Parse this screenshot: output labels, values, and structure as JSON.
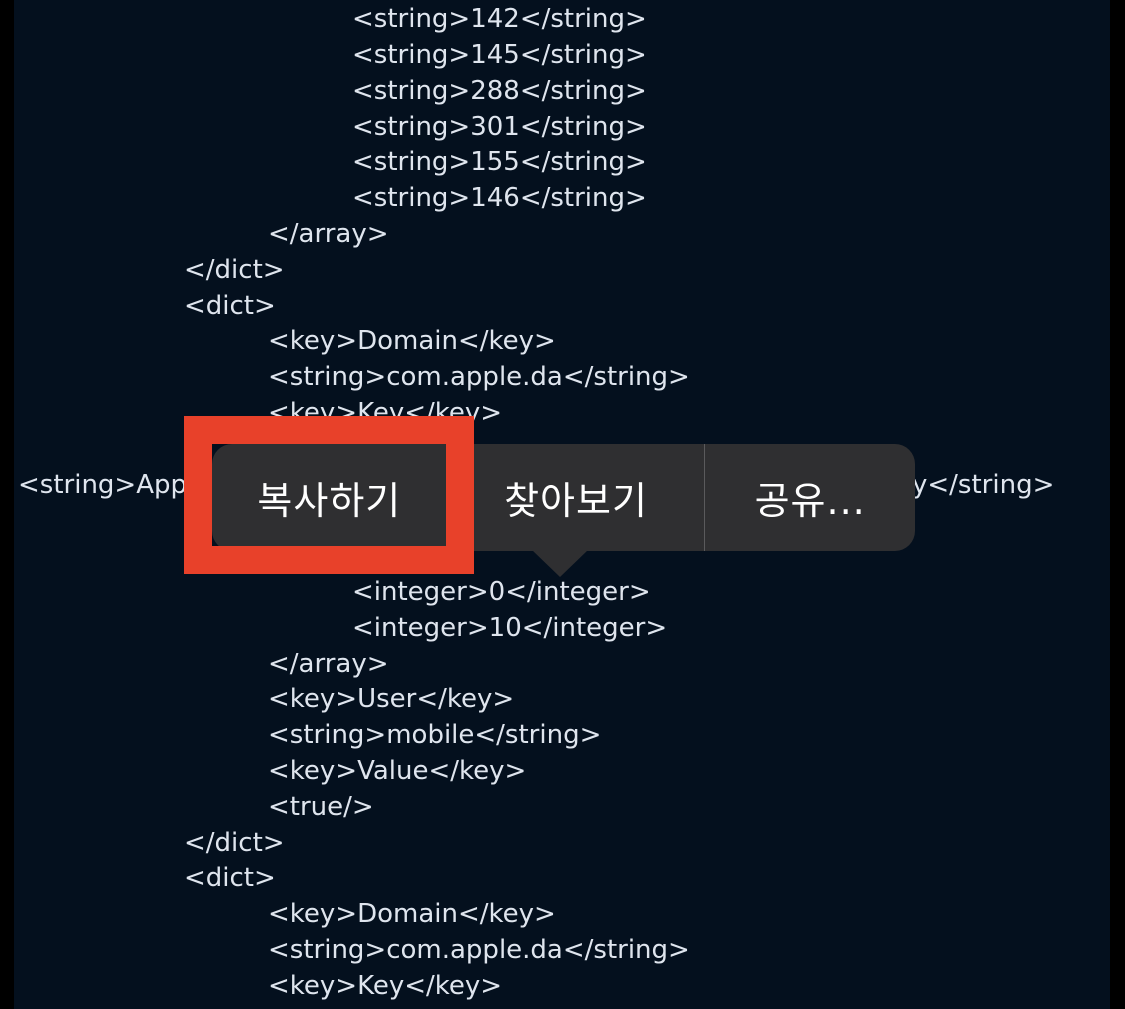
{
  "code_lines": [
    "<string>142</string>",
    "<string>145</string>",
    "<string>288</string>",
    "<string>301</string>",
    "<string>155</string>",
    "<string>146</string>",
    "</array>",
    "</dict>",
    "<dict>",
    "<key>Domain</key>",
    "<string>com.apple.da</string>",
    "<key>Key</key>",
    "<string>App",
    "y</string>",
    "<integer>0</integer>",
    "<integer>10</integer>",
    "</array>",
    "<key>User</key>",
    "<string>mobile</string>",
    "<key>Value</key>",
    "<true/>",
    "</dict>",
    "<dict>",
    "<key>Domain</key>",
    "<string>com.apple.da</string>",
    "<key>Key</key>"
  ],
  "context_menu": {
    "copy_label": "복사하기",
    "lookup_label": "찾아보기",
    "share_label": "공유..."
  },
  "colors": {
    "background": "#04101e",
    "text": "#dfe5ee",
    "menu_background": "#2f2f31",
    "highlight": "#e8412a"
  }
}
